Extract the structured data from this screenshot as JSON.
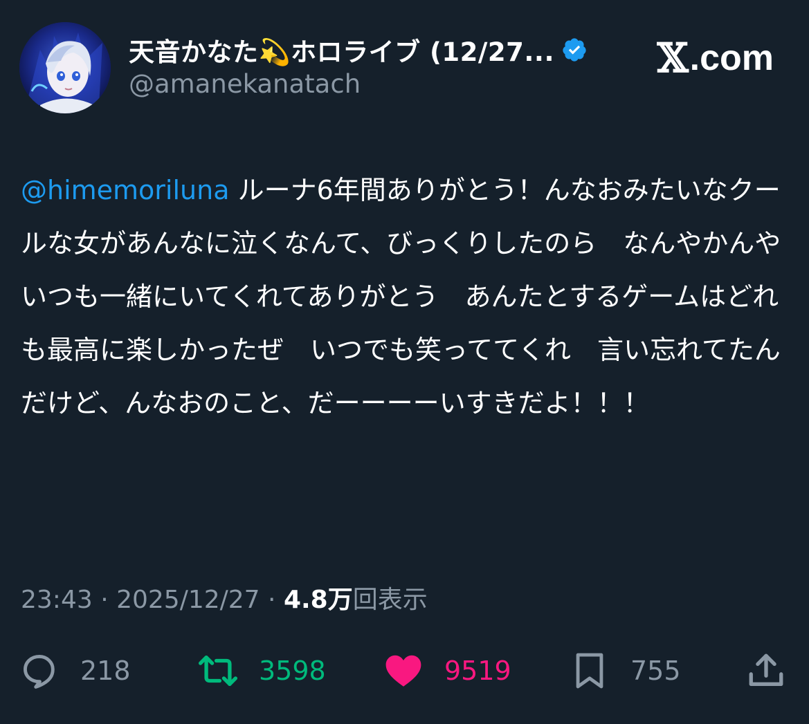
{
  "author": {
    "display_name": "天音かなた💫ホロライブ (12/27...",
    "handle": "@amanekanatach",
    "verified_icon": "verified-badge-icon",
    "avatar_icon": "avatar"
  },
  "brand": {
    "logo_symbol": "𝕏",
    "domain_suffix": ".com"
  },
  "tweet": {
    "mention": "@himemoriluna",
    "body": " ルーナ6年間ありがとう！んなおみたいなクールな女があんなに泣くなんて、びっくりしたのら　なんやかんやいつも一緒にいてくれてありがとう　あんたとするゲームはどれも最高に楽しかったぜ　いつでも笑っててくれ　言い忘れてたんだけど、んなおのこと、だーーーーいすきだよ！！！"
  },
  "meta": {
    "time": "23:43",
    "separator": " · ",
    "date": "2025/12/27",
    "views_count": "4.8万",
    "views_label": "回表示"
  },
  "actions": {
    "reply_count": "218",
    "retweet_count": "3598",
    "like_count": "9519",
    "bookmark_count": "755"
  },
  "colors": {
    "background": "#15202b",
    "mention": "#1d9bf0",
    "secondary_text": "#8b98a5",
    "retweet": "#00ba7c",
    "like": "#f91880",
    "verified": "#1d9bf0"
  }
}
